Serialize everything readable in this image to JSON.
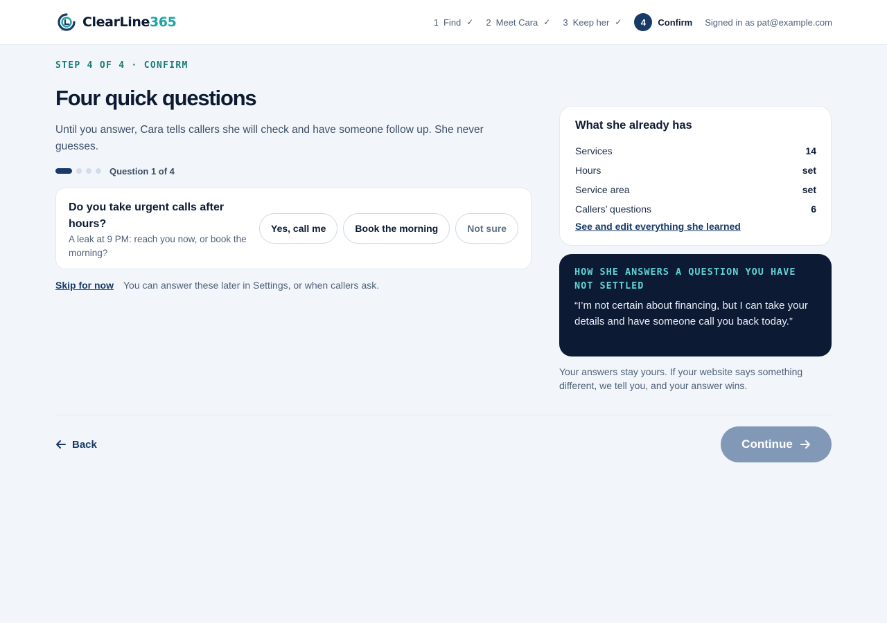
{
  "brand": {
    "name_main": "ClearLine",
    "name_accent": "365"
  },
  "steps": [
    {
      "num": "1",
      "label": "Find",
      "done": "✓"
    },
    {
      "num": "2",
      "label": "Meet Cara",
      "done": "✓"
    },
    {
      "num": "3",
      "label": "Keep her",
      "done": "✓"
    },
    {
      "num": "4",
      "label": "Confirm"
    }
  ],
  "account": {
    "signed_in": "Signed in as pat@example.com"
  },
  "main": {
    "eyebrow": "STEP 4 OF 4 · CONFIRM",
    "title": "Four quick questions",
    "intro": "Until you answer, Cara tells callers she will check and have someone follow up. She never guesses.",
    "progress_label": "Question 1 of 4",
    "question": {
      "title": "Do you take urgent calls after hours?",
      "subtitle": "A leak at 9 PM: reach you now, or book the morning?",
      "options": [
        "Yes, call me",
        "Book the morning",
        "Not sure"
      ]
    },
    "skip_label": "Skip for now",
    "skip_note": "You can answer these later in Settings, or when callers ask."
  },
  "summary": {
    "heading": "What she already has",
    "facts": [
      {
        "label": "Services",
        "value": "14"
      },
      {
        "label": "Hours",
        "value": "set"
      },
      {
        "label": "Service area",
        "value": "set"
      },
      {
        "label": "Callers’ questions",
        "value": "6"
      }
    ],
    "edit_link": "See and edit everything she learned"
  },
  "example": {
    "heading": "HOW SHE ANSWERS A QUESTION YOU HAVE NOT SETTLED",
    "quote": "“I’m not certain about financing, but I can take your details and have someone call you back today.”"
  },
  "note": "Your answers stay yours. If your website says something different, we tell you, and your answer wins.",
  "nav": {
    "back": "Back",
    "continue": "Continue"
  },
  "colors": {
    "accent": "#1fa3a3",
    "primary": "#173a66",
    "dark": "#0c1a33",
    "disabled_button": "#8199b7"
  }
}
